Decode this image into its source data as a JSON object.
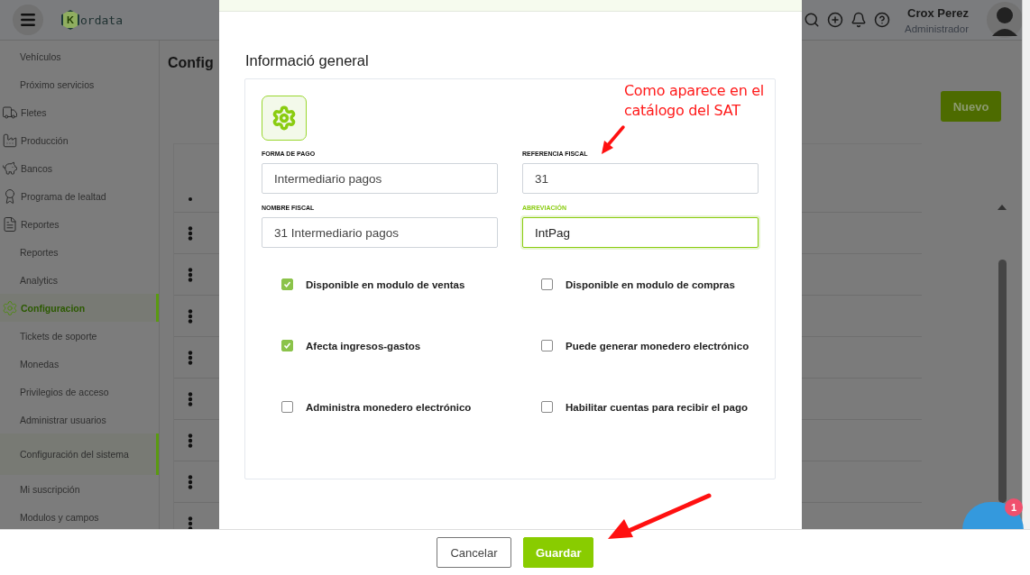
{
  "header": {
    "logo": {
      "mark": "K",
      "text": "ordata"
    },
    "user": {
      "name": "Crox Perez",
      "role": "Administrador"
    }
  },
  "sidebar": {
    "items": [
      {
        "label": "Vehículos",
        "kind": "sub",
        "selected": false
      },
      {
        "label": "Próximo servicios",
        "kind": "sub",
        "selected": false
      },
      {
        "label": "Fletes",
        "kind": "section",
        "selected": false
      },
      {
        "label": "Producción",
        "kind": "section",
        "selected": false
      },
      {
        "label": "Bancos",
        "kind": "section",
        "selected": false
      },
      {
        "label": "Programa de lealtad",
        "kind": "section",
        "selected": false
      },
      {
        "label": "Reportes",
        "kind": "section",
        "selected": false
      },
      {
        "label": "Reportes",
        "kind": "sub",
        "selected": false
      },
      {
        "label": "Analytics",
        "kind": "sub",
        "selected": false
      },
      {
        "label": "Configuracion",
        "kind": "section",
        "selected": true
      },
      {
        "label": "Tickets de soporte",
        "kind": "sub",
        "selected": false
      },
      {
        "label": "Monedas",
        "kind": "sub",
        "selected": false
      },
      {
        "label": "Privilegios de acceso",
        "kind": "sub",
        "selected": false
      },
      {
        "label": "Administrar usuarios",
        "kind": "sub",
        "selected": false
      },
      {
        "label": "Configuración del sistema",
        "kind": "sub",
        "selected": true
      },
      {
        "label": "Mi suscripción",
        "kind": "sub",
        "selected": false
      },
      {
        "label": "Modulos y campos",
        "kind": "sub",
        "selected": false
      }
    ]
  },
  "page": {
    "title": "Config",
    "new_button": "Nuevo"
  },
  "modal": {
    "section_title": "Informació general",
    "fields": [
      {
        "label": "FORMA DE PAGO",
        "value": "Intermediario pagos",
        "focused": false
      },
      {
        "label": "REFERENCIA FISCAL",
        "value": "31",
        "focused": false
      },
      {
        "label": "NOMBRE FISCAL",
        "value": "31 Intermediario pagos",
        "focused": false
      },
      {
        "label": "ABREVIACIÓN",
        "value": "IntPag",
        "focused": true
      }
    ],
    "options": [
      {
        "label": "Disponible en modulo de ventas",
        "checked": true
      },
      {
        "label": "Disponible en modulo de compras",
        "checked": false
      },
      {
        "label": "Afecta ingresos-gastos",
        "checked": true
      },
      {
        "label": "Puede generar monedero electrónico",
        "checked": false
      },
      {
        "label": "Administra monedero electrónico",
        "checked": false
      },
      {
        "label": "Habilitar cuentas para recibir el pago",
        "checked": false
      }
    ]
  },
  "annotation": {
    "text": "Como aparece en el catálogo del SAT"
  },
  "chat": {
    "badge": "1"
  },
  "footer": {
    "buttons": [
      {
        "label": "Cancelar",
        "kind": "secondary"
      },
      {
        "label": "Guardar",
        "kind": "primary"
      }
    ]
  }
}
